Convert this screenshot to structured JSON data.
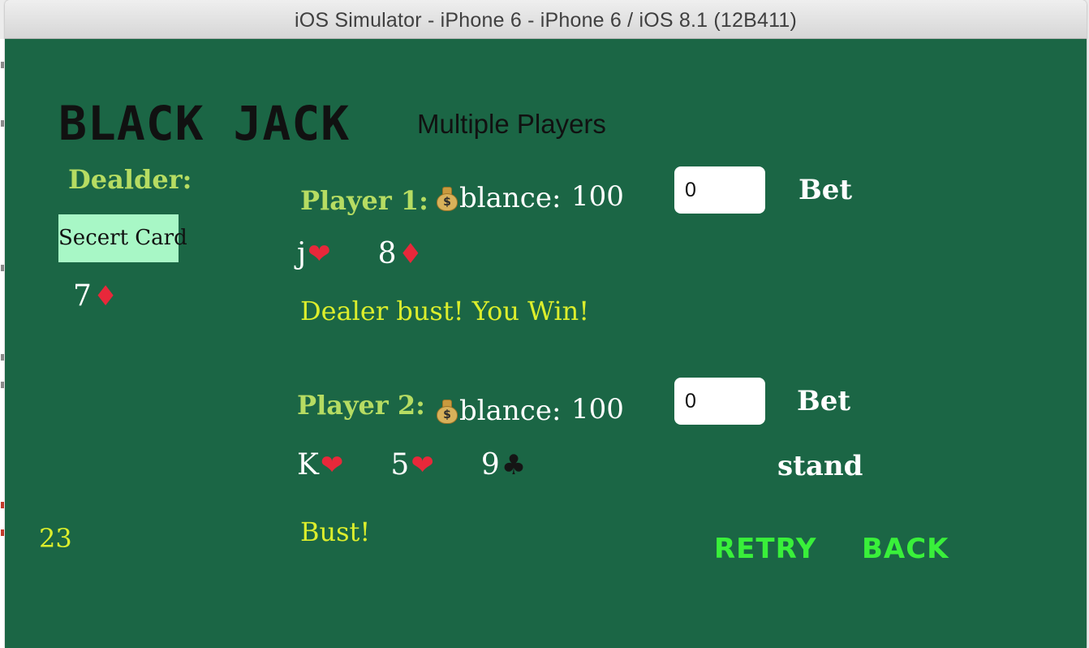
{
  "window": {
    "title": "iOS Simulator - iPhone 6 - iPhone 6 / iOS 8.1 (12B411)"
  },
  "app": {
    "title": "BLACK JACK",
    "subtitle": "Multiple Players"
  },
  "dealer": {
    "label": "Dealder:",
    "secret_card_label": "Secert Card",
    "cards": [
      {
        "rank": "7",
        "suit": "diamond",
        "suit_glyph": "♦"
      }
    ],
    "score": "23"
  },
  "players": [
    {
      "label": "Player 1:",
      "balance_label": "blance:",
      "balance_icon": "money-bag-icon",
      "balance_value": "100",
      "bet_value": "0",
      "bet_label": "Bet",
      "cards": [
        {
          "rank": "j",
          "suit": "heart",
          "suit_glyph": "❤"
        },
        {
          "rank": "8",
          "suit": "diamond",
          "suit_glyph": "♦"
        }
      ],
      "status": "Dealer bust! You Win!"
    },
    {
      "label": "Player 2:",
      "balance_label": "blance:",
      "balance_icon": "money-bag-icon",
      "balance_value": "100",
      "bet_value": "0",
      "bet_label": "Bet",
      "stand_label": "stand",
      "cards": [
        {
          "rank": "K",
          "suit": "heart",
          "suit_glyph": "❤"
        },
        {
          "rank": "5",
          "suit": "heart",
          "suit_glyph": "❤"
        },
        {
          "rank": "9",
          "suit": "club",
          "suit_glyph": "♣"
        }
      ],
      "status": "Bust!"
    }
  ],
  "actions": {
    "retry_label": "RETRY",
    "back_label": "BACK"
  },
  "colors": {
    "table_green": "#1b6645",
    "label_green": "#b6dc62",
    "status_yellow": "#dcee2c",
    "nav_green": "#39f03a",
    "secret_card_bg": "#a8f7c6",
    "suit_red": "#e8283a"
  }
}
